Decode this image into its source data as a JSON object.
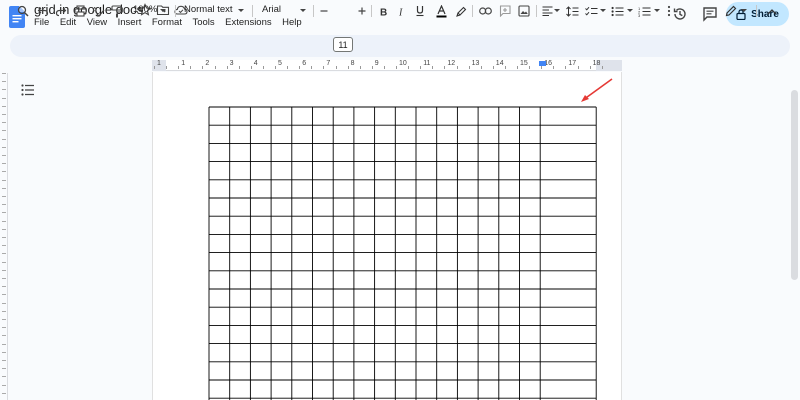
{
  "document": {
    "title": "grid in google docs"
  },
  "menu": {
    "items": [
      "File",
      "Edit",
      "View",
      "Insert",
      "Format",
      "Tools",
      "Extensions",
      "Help"
    ]
  },
  "header": {
    "share_label": "Share"
  },
  "toolbar": {
    "zoom": "100%",
    "style": "Normal text",
    "font": "Arial",
    "font_size": "11"
  },
  "ruler": {
    "labels": [
      "1",
      "1",
      "2",
      "3",
      "4",
      "5",
      "6",
      "7",
      "8",
      "9",
      "10",
      "11",
      "12",
      "13",
      "14",
      "15",
      "16",
      "17",
      "18"
    ]
  },
  "table": {
    "rows": 18,
    "columns": 17
  },
  "colors": {
    "share_bg": "#c2e7ff",
    "toolbar_bg": "#edf2fa",
    "docs_blue": "#4285f4",
    "annotation_arrow": "#e53935"
  }
}
